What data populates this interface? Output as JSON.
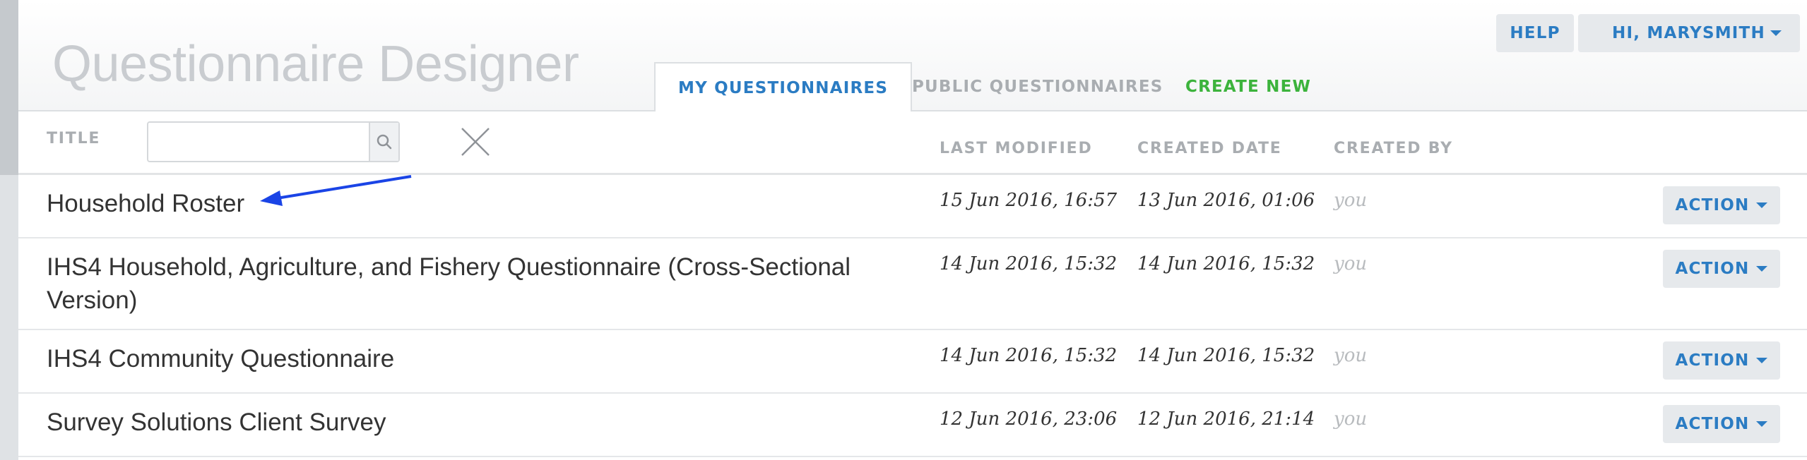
{
  "header": {
    "app_title": "Questionnaire Designer",
    "tabs": [
      {
        "label": "MY QUESTIONNAIRES",
        "active": true
      },
      {
        "label": "PUBLIC QUESTIONNAIRES",
        "active": false
      },
      {
        "label": "CREATE NEW",
        "active": false
      }
    ],
    "help_label": "HELP",
    "user_label": "HI, MARYSMITH"
  },
  "filter": {
    "title_label": "TITLE",
    "search_value": "",
    "search_icon": "search-icon",
    "clear_icon": "close-icon"
  },
  "columns": {
    "last_modified": "LAST MODIFIED",
    "created_date": "CREATED DATE",
    "created_by": "CREATED BY"
  },
  "questionnaires": [
    {
      "title": "Household Roster",
      "last_modified": "15 Jun 2016, 16:57",
      "created_date": "13 Jun 2016, 01:06",
      "created_by": "you",
      "action_label": "ACTION"
    },
    {
      "title": "IHS4 Household, Agriculture, and Fishery Questionnaire (Cross-Sectional Version)",
      "last_modified": "14 Jun 2016, 15:32",
      "created_date": "14 Jun 2016, 15:32",
      "created_by": "you",
      "action_label": "ACTION"
    },
    {
      "title": "IHS4 Community Questionnaire",
      "last_modified": "14 Jun 2016, 15:32",
      "created_date": "14 Jun 2016, 15:32",
      "created_by": "you",
      "action_label": "ACTION"
    },
    {
      "title": "Survey Solutions Client Survey",
      "last_modified": "12 Jun 2016, 23:06",
      "created_date": "12 Jun 2016, 21:14",
      "created_by": "you",
      "action_label": "ACTION"
    }
  ],
  "colors": {
    "accent": "#2b7cc3",
    "create_new": "#3cb33c",
    "muted": "#a9adb1",
    "annotation_arrow": "#1a44e6"
  }
}
